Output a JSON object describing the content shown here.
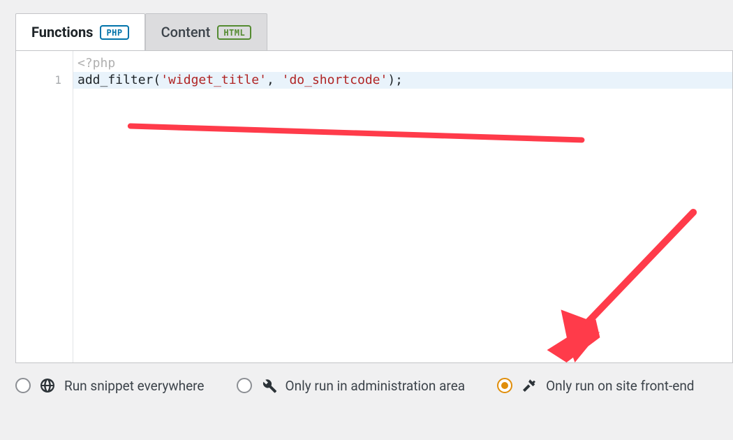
{
  "tabs": {
    "functions_label": "Functions",
    "functions_badge": "PHP",
    "content_label": "Content",
    "content_badge": "HTML"
  },
  "code": {
    "open_tag": "<?php",
    "line1_func": "add_filter",
    "line1_open": "(",
    "line1_arg1": "'widget_title'",
    "line1_comma": ", ",
    "line1_arg2": "'do_shortcode'",
    "line1_close": ");"
  },
  "options": {
    "everywhere": "Run snippet everywhere",
    "admin": "Only run in administration area",
    "frontend": "Only run on site front-end",
    "selected": "frontend"
  }
}
